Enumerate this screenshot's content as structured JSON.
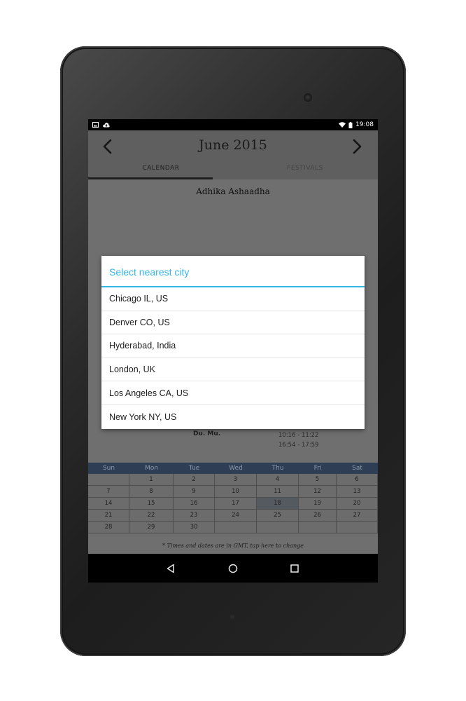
{
  "status_bar": {
    "time": "19:08"
  },
  "header": {
    "title": "June 2015",
    "prev_arrow": "‹",
    "next_arrow": "›",
    "tabs": [
      {
        "label": "CALENDAR",
        "active": true
      },
      {
        "label": "FESTIVALS",
        "active": false
      }
    ]
  },
  "subtitle": "Adhika Ashaadha",
  "muhurta": {
    "label": "Du. Mu.",
    "times": [
      "10:16 - 11:22",
      "16:54 - 17:59"
    ]
  },
  "calendar": {
    "weekdays": [
      "Sun",
      "Mon",
      "Tue",
      "Wed",
      "Thu",
      "Fri",
      "Sat"
    ],
    "weeks": [
      [
        "",
        "1",
        "2",
        "3",
        "4",
        "5",
        "6"
      ],
      [
        "7",
        "8",
        "9",
        "10",
        "11",
        "12",
        "13"
      ],
      [
        "14",
        "15",
        "16",
        "17",
        "18",
        "19",
        "20"
      ],
      [
        "21",
        "22",
        "23",
        "24",
        "25",
        "26",
        "27"
      ],
      [
        "28",
        "29",
        "30",
        "",
        "",
        "",
        ""
      ]
    ],
    "highlighted": "18",
    "footnote": "* Times and dates are in GMT, tap here to change"
  },
  "dialog": {
    "title": "Select nearest city",
    "accent_color": "#33b5e5",
    "cities": [
      "Chicago IL, US",
      "Denver CO, US",
      "Hyderabad, India",
      "London, UK",
      "Los Angeles CA, US",
      "New York NY, US"
    ]
  },
  "nav_bar": {
    "buttons": [
      "back-icon",
      "home-icon",
      "recents-icon"
    ]
  }
}
